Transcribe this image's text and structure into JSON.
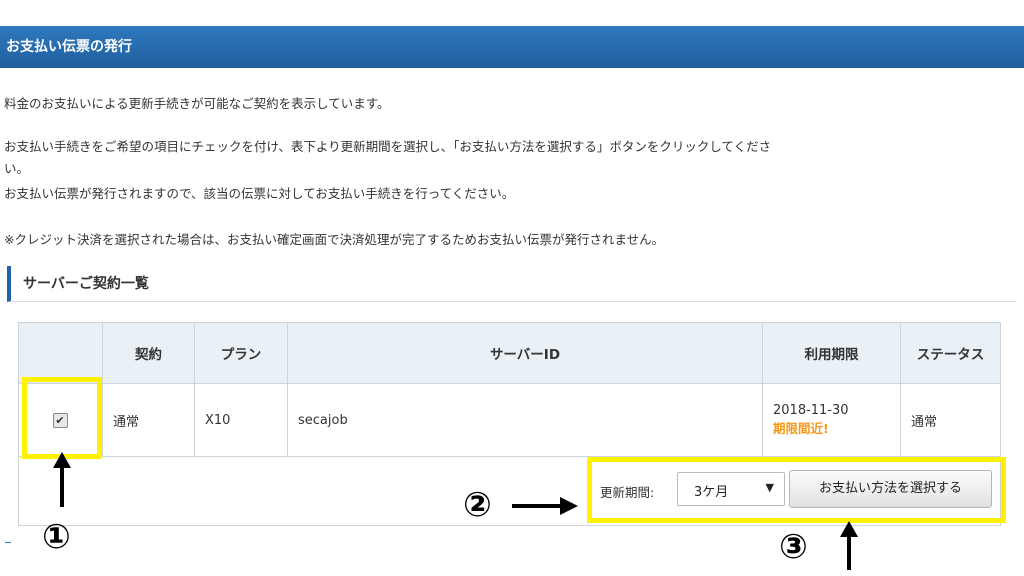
{
  "header": {
    "title": "お支払い伝票の発行"
  },
  "intro": {
    "line1": "料金のお支払いによる更新手続きが可能なご契約を表示しています。",
    "line2": "お支払い手続きをご希望の項目にチェックを付け、表下より更新期間を選択し、「お支払い方法を選択する」ボタンをクリックしてくださ",
    "line2b": "い。",
    "line3": "お支払い伝票が発行されますので、該当の伝票に対してお支払い手続きを行ってください。",
    "note": "※クレジット決済を選択された場合は、お支払い確定画面で決済処理が完了するためお支払い伝票が発行されません。"
  },
  "section": {
    "title": "サーバーご契約一覧"
  },
  "table": {
    "headers": [
      "",
      "契約",
      "プラン",
      "サーバーID",
      "利用期限",
      "ステータス"
    ],
    "rows": [
      {
        "checked": true,
        "contract": "通常",
        "plan": "X10",
        "server_id": "secajob",
        "expiry": "2018-11-30",
        "expiry_warning": "期限間近!",
        "status": "通常"
      }
    ]
  },
  "renewal": {
    "label": "更新期間:",
    "selected": "3ケ月",
    "button": "お支払い方法を選択する"
  },
  "annotations": {
    "step1": "①",
    "step2": "②",
    "step3": "③"
  },
  "colors": {
    "header_blue": "#1f64ad",
    "highlight": "#fff200",
    "warning": "#f39a1d"
  }
}
